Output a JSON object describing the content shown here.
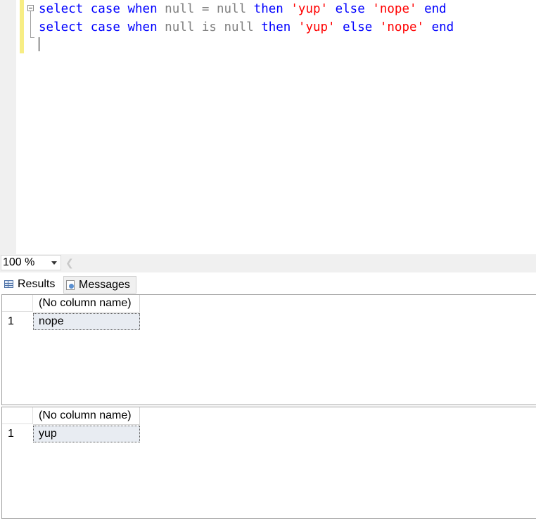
{
  "editor": {
    "lines": [
      [
        {
          "text": "select",
          "cls": "kw"
        },
        {
          "text": " ",
          "cls": ""
        },
        {
          "text": "case",
          "cls": "kw"
        },
        {
          "text": " ",
          "cls": ""
        },
        {
          "text": "when",
          "cls": "kw"
        },
        {
          "text": " ",
          "cls": ""
        },
        {
          "text": "null",
          "cls": "gr"
        },
        {
          "text": " ",
          "cls": ""
        },
        {
          "text": "=",
          "cls": "gr"
        },
        {
          "text": " ",
          "cls": ""
        },
        {
          "text": "null",
          "cls": "gr"
        },
        {
          "text": " ",
          "cls": ""
        },
        {
          "text": "then",
          "cls": "kw"
        },
        {
          "text": " ",
          "cls": ""
        },
        {
          "text": "'yup'",
          "cls": "st"
        },
        {
          "text": " ",
          "cls": ""
        },
        {
          "text": "else",
          "cls": "kw"
        },
        {
          "text": " ",
          "cls": ""
        },
        {
          "text": "'nope'",
          "cls": "st"
        },
        {
          "text": " ",
          "cls": ""
        },
        {
          "text": "end",
          "cls": "kw"
        }
      ],
      [
        {
          "text": "select",
          "cls": "kw"
        },
        {
          "text": " ",
          "cls": ""
        },
        {
          "text": "case",
          "cls": "kw"
        },
        {
          "text": " ",
          "cls": ""
        },
        {
          "text": "when",
          "cls": "kw"
        },
        {
          "text": " ",
          "cls": ""
        },
        {
          "text": "null",
          "cls": "gr"
        },
        {
          "text": " ",
          "cls": ""
        },
        {
          "text": "is",
          "cls": "gr"
        },
        {
          "text": " ",
          "cls": ""
        },
        {
          "text": "null",
          "cls": "gr"
        },
        {
          "text": " ",
          "cls": ""
        },
        {
          "text": "then",
          "cls": "kw"
        },
        {
          "text": " ",
          "cls": ""
        },
        {
          "text": "'yup'",
          "cls": "st"
        },
        {
          "text": " ",
          "cls": ""
        },
        {
          "text": "else",
          "cls": "kw"
        },
        {
          "text": " ",
          "cls": ""
        },
        {
          "text": "'nope'",
          "cls": "st"
        },
        {
          "text": " ",
          "cls": ""
        },
        {
          "text": "end",
          "cls": "kw"
        }
      ]
    ]
  },
  "zoom": {
    "value": "100 %"
  },
  "tabs": {
    "results_label": "Results",
    "messages_label": "Messages"
  },
  "results": [
    {
      "column_header": "(No column name)",
      "row_number": "1",
      "value": "nope"
    },
    {
      "column_header": "(No column name)",
      "row_number": "1",
      "value": "yup"
    }
  ],
  "colors": {
    "keyword": "#0000ff",
    "operator": "#808080",
    "string": "#ff0000",
    "change_bar": "#f7ed84"
  },
  "icons": {
    "results_tab": "grid-icon",
    "messages_tab": "message-icon",
    "fold": "collapse-icon",
    "scroll": "chevron-left-icon",
    "zoom_dropdown": "chevron-down-icon"
  }
}
